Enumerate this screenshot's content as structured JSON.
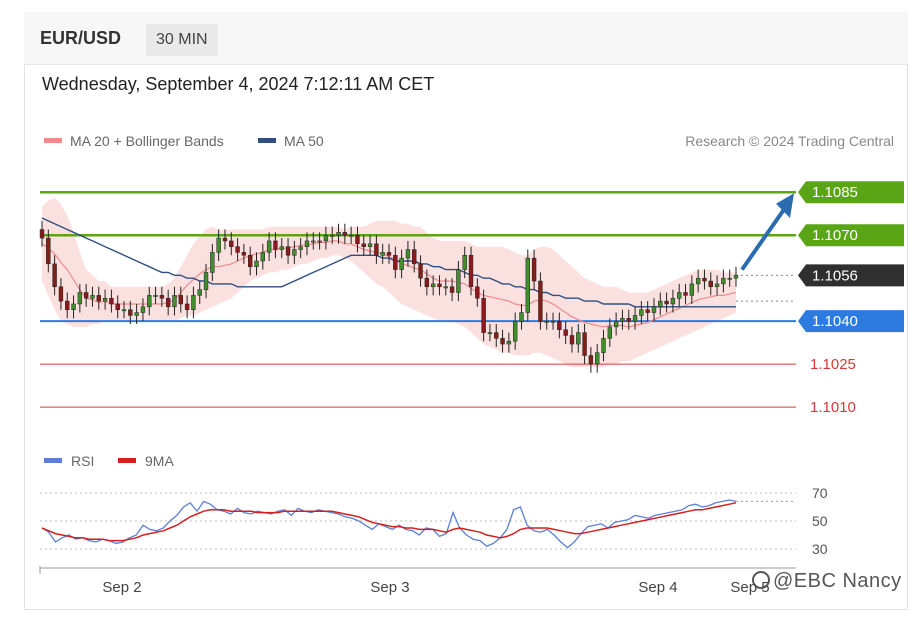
{
  "header": {
    "pair": "EUR/USD",
    "timeframe": "30 MIN"
  },
  "timestamp": "Wednesday, September 4, 2024 7:12:11 AM CET",
  "legend": [
    {
      "label": "MA 20 + Bollinger Bands",
      "color": "#f08a8a"
    },
    {
      "label": "MA 50",
      "color": "#2f4f80"
    }
  ],
  "copyright": "Research © 2024 Trading Central",
  "watermark": "@EBC  Nancy",
  "chart_data": {
    "type": "line",
    "title": "EUR/USD",
    "price_ylim": [
      1.1002,
      1.1098
    ],
    "levels": [
      {
        "label": "1.1085",
        "value": 1.1085,
        "kind": "resistance",
        "color": "#5aa516"
      },
      {
        "label": "1.1070",
        "value": 1.107,
        "kind": "resistance",
        "color": "#5aa516"
      },
      {
        "label": "1.1056",
        "value": 1.1056,
        "kind": "last",
        "color": "#333333"
      },
      {
        "label": "1.1040",
        "value": 1.104,
        "kind": "support",
        "color": "#2e7be0"
      },
      {
        "label": "1.1025",
        "value": 1.1025,
        "kind": "support",
        "color": "#d43a3a"
      },
      {
        "label": "1.1010",
        "value": 1.101,
        "kind": "support",
        "color": "#d43a3a"
      }
    ],
    "x_ticks": [
      "Sep 2",
      "Sep 3",
      "Sep 4",
      "Sep 5"
    ],
    "close": [
      1.1069,
      1.106,
      1.1052,
      1.1047,
      1.1044,
      1.1046,
      1.105,
      1.1048,
      1.1049,
      1.1047,
      1.1048,
      1.1046,
      1.1044,
      1.1044,
      1.1042,
      1.1043,
      1.1045,
      1.1049,
      1.1049,
      1.1048,
      1.1045,
      1.1049,
      1.1046,
      1.1044,
      1.1049,
      1.1051,
      1.1057,
      1.1064,
      1.1069,
      1.1068,
      1.1066,
      1.1064,
      1.1063,
      1.1059,
      1.1061,
      1.1064,
      1.1068,
      1.1065,
      1.1066,
      1.1063,
      1.1065,
      1.1066,
      1.1068,
      1.1068,
      1.1068,
      1.107,
      1.107,
      1.1071,
      1.107,
      1.107,
      1.1067,
      1.1066,
      1.1067,
      1.1063,
      1.1064,
      1.1063,
      1.1058,
      1.1062,
      1.1065,
      1.106,
      1.1055,
      1.1052,
      1.1053,
      1.1052,
      1.1052,
      1.105,
      1.1058,
      1.1063,
      1.1052,
      1.1048,
      1.1036,
      1.1036,
      1.1034,
      1.1032,
      1.1033,
      1.104,
      1.1043,
      1.1062,
      1.1054,
      1.104,
      1.104,
      1.104,
      1.1037,
      1.1035,
      1.1032,
      1.1036,
      1.1028,
      1.1025,
      1.1029,
      1.1034,
      1.1038,
      1.104,
      1.1041,
      1.104,
      1.1042,
      1.1044,
      1.1043,
      1.1045,
      1.1047,
      1.1046,
      1.1048,
      1.105,
      1.1049,
      1.1053,
      1.1055,
      1.1054,
      1.1052,
      1.1053,
      1.1055,
      1.1055,
      1.1056
    ],
    "bollinger_upper": [
      1.108,
      1.1082,
      1.1083,
      1.1081,
      1.1077,
      1.1071,
      1.1064,
      1.1058,
      1.1056,
      1.1054,
      1.1054,
      1.1052,
      1.1052,
      1.1052,
      1.1052,
      1.1052,
      1.1052,
      1.1052,
      1.1052,
      1.1052,
      1.1053,
      1.1055,
      1.1059,
      1.1063,
      1.1067,
      1.107,
      1.1072,
      1.1073,
      1.1072,
      1.1072,
      1.1072,
      1.1072,
      1.1072,
      1.1072,
      1.1072,
      1.1072,
      1.1073,
      1.1073,
      1.1073,
      1.1073,
      1.1073,
      1.1073,
      1.1073,
      1.1073,
      1.1073,
      1.1073,
      1.1073,
      1.1073,
      1.1072,
      1.1073,
      1.1073,
      1.1073,
      1.1074,
      1.1075,
      1.1075,
      1.1075,
      1.1075,
      1.1074,
      1.1074,
      1.1073,
      1.1073,
      1.1071,
      1.1069,
      1.1068,
      1.1068,
      1.1068,
      1.1068,
      1.1068,
      1.1067,
      1.1066,
      1.1066,
      1.1066,
      1.1066,
      1.1066,
      1.1065,
      1.1064,
      1.1063,
      1.1063,
      1.1065,
      1.1066,
      1.1066,
      1.1065,
      1.1063,
      1.1061,
      1.1059,
      1.1057,
      1.1055,
      1.1054,
      1.1053,
      1.1052,
      1.1052,
      1.1052,
      1.1051,
      1.105,
      1.105,
      1.105,
      1.105,
      1.1051,
      1.1052,
      1.1053,
      1.1054,
      1.1055,
      1.1056,
      1.1057,
      1.1058,
      1.1058,
      1.1058,
      1.1058,
      1.1057,
      1.1057,
      1.1057
    ],
    "bollinger_lower": [
      1.1054,
      1.1049,
      1.1044,
      1.104,
      1.1039,
      1.1038,
      1.1038,
      1.1038,
      1.1039,
      1.1039,
      1.104,
      1.104,
      1.104,
      1.104,
      1.104,
      1.104,
      1.104,
      1.104,
      1.104,
      1.104,
      1.104,
      1.104,
      1.1041,
      1.1042,
      1.1042,
      1.1043,
      1.1044,
      1.1045,
      1.1046,
      1.1047,
      1.1048,
      1.105,
      1.1052,
      1.1054,
      1.1055,
      1.1056,
      1.1057,
      1.1057,
      1.1058,
      1.1058,
      1.1059,
      1.106,
      1.106,
      1.1061,
      1.1062,
      1.1062,
      1.1063,
      1.1063,
      1.1062,
      1.1061,
      1.1059,
      1.1057,
      1.1055,
      1.1053,
      1.1052,
      1.105,
      1.1048,
      1.1046,
      1.1045,
      1.1044,
      1.1043,
      1.1042,
      1.1041,
      1.104,
      1.104,
      1.104,
      1.1039,
      1.1038,
      1.1036,
      1.1034,
      1.1032,
      1.1031,
      1.103,
      1.1029,
      1.1029,
      1.1028,
      1.1028,
      1.1028,
      1.1029,
      1.1029,
      1.1028,
      1.1027,
      1.1026,
      1.1025,
      1.1024,
      1.1024,
      1.1024,
      1.1024,
      1.1024,
      1.1024,
      1.1025,
      1.1025,
      1.1026,
      1.1026,
      1.1027,
      1.1028,
      1.1029,
      1.103,
      1.1031,
      1.1032,
      1.1033,
      1.1034,
      1.1035,
      1.1036,
      1.1037,
      1.1038,
      1.1039,
      1.104,
      1.1041,
      1.1042,
      1.1043
    ],
    "ma50": [
      1.1076,
      1.1075,
      1.1074,
      1.1073,
      1.1072,
      1.1071,
      1.107,
      1.1069,
      1.1068,
      1.1067,
      1.1066,
      1.1065,
      1.1064,
      1.1063,
      1.1062,
      1.1061,
      1.106,
      1.1059,
      1.1058,
      1.1057,
      1.1057,
      1.1056,
      1.1056,
      1.1055,
      1.1055,
      1.1054,
      1.1054,
      1.1053,
      1.1053,
      1.1053,
      1.1053,
      1.1052,
      1.1052,
      1.1052,
      1.1052,
      1.1052,
      1.1052,
      1.1052,
      1.1052,
      1.1053,
      1.1054,
      1.1055,
      1.1056,
      1.1057,
      1.1058,
      1.1059,
      1.106,
      1.1061,
      1.1062,
      1.1063,
      1.1063,
      1.1063,
      1.1063,
      1.1063,
      1.1062,
      1.1062,
      1.1061,
      1.1061,
      1.1061,
      1.1061,
      1.106,
      1.106,
      1.1059,
      1.1059,
      1.1058,
      1.1058,
      1.1058,
      1.1057,
      1.1056,
      1.1056,
      1.1055,
      1.1055,
      1.1054,
      1.1053,
      1.1053,
      1.1052,
      1.1052,
      1.1051,
      1.1051,
      1.105,
      1.105,
      1.1049,
      1.1049,
      1.1048,
      1.1048,
      1.1048,
      1.1047,
      1.1047,
      1.1047,
      1.1046,
      1.1046,
      1.1046,
      1.1046,
      1.1046,
      1.1045,
      1.1045,
      1.1045,
      1.1045,
      1.1045,
      1.1045,
      1.1045,
      1.1045,
      1.1045,
      1.1045,
      1.1045,
      1.1045,
      1.1045,
      1.1045,
      1.1045,
      1.1045,
      1.1045
    ],
    "rsi_panel": {
      "legend": [
        {
          "label": "RSI",
          "color": "#5b7fd6"
        },
        {
          "label": "9MA",
          "color": "#d42020"
        }
      ],
      "ylim": [
        25,
        75
      ],
      "ticks": [
        "70",
        "50",
        "30"
      ],
      "rsi": [
        45,
        42,
        35,
        38,
        40,
        37,
        38,
        36,
        35,
        37,
        36,
        34,
        35,
        38,
        40,
        47,
        44,
        43,
        45,
        50,
        54,
        60,
        63,
        57,
        64,
        62,
        58,
        57,
        55,
        59,
        56,
        55,
        57,
        56,
        55,
        57,
        58,
        54,
        59,
        57,
        56,
        58,
        57,
        56,
        55,
        53,
        52,
        50,
        47,
        44,
        48,
        46,
        44,
        47,
        44,
        43,
        40,
        45,
        44,
        39,
        41,
        56,
        45,
        40,
        37,
        36,
        32,
        34,
        38,
        44,
        58,
        60,
        47,
        43,
        42,
        44,
        40,
        35,
        31,
        35,
        41,
        46,
        47,
        48,
        45,
        49,
        50,
        51,
        54,
        53,
        52,
        54,
        55,
        56,
        57,
        58,
        61,
        62,
        60,
        61,
        63,
        64,
        65,
        64
      ],
      "rsi_ma": [
        45,
        43,
        41,
        40,
        39,
        38,
        38,
        37,
        37,
        37,
        36,
        36,
        36,
        37,
        38,
        40,
        41,
        42,
        43,
        45,
        47,
        50,
        53,
        55,
        57,
        58,
        58,
        58,
        57,
        57,
        57,
        57,
        56,
        56,
        56,
        56,
        57,
        57,
        57,
        57,
        57,
        57,
        57,
        57,
        56,
        55,
        54,
        53,
        51,
        49,
        48,
        47,
        46,
        46,
        45,
        45,
        44,
        44,
        44,
        43,
        42,
        44,
        45,
        44,
        43,
        42,
        40,
        39,
        38,
        39,
        41,
        44,
        45,
        45,
        45,
        45,
        44,
        43,
        42,
        41,
        41,
        42,
        43,
        44,
        45,
        46,
        47,
        48,
        49,
        50,
        51,
        52,
        53,
        54,
        55,
        56,
        57,
        58,
        58,
        59,
        60,
        61,
        62,
        63
      ]
    }
  }
}
